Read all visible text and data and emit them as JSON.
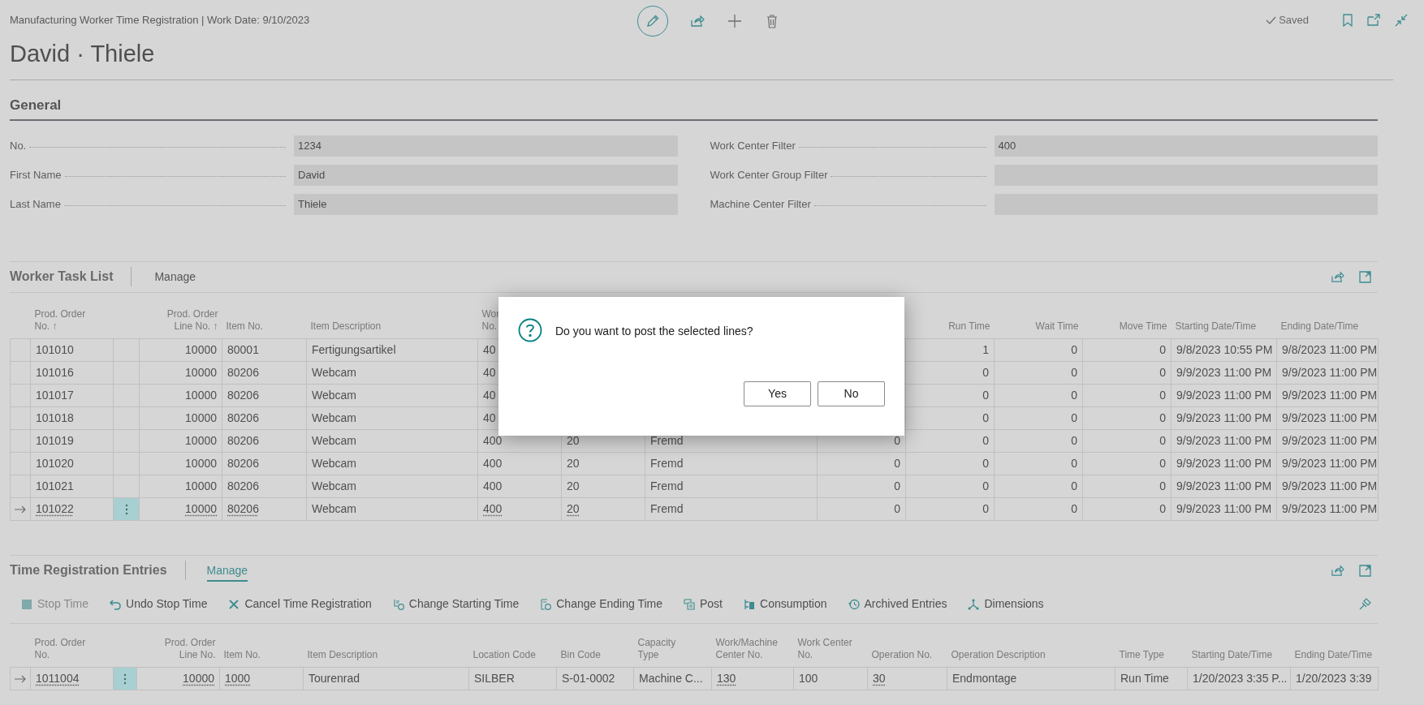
{
  "header": {
    "title": "Manufacturing Worker Time Registration | Work Date: 9/10/2023",
    "record_name": "David · Thiele",
    "status": "Saved"
  },
  "general": {
    "title": "General",
    "left_fields": [
      {
        "label": "No.",
        "value": "1234"
      },
      {
        "label": "First Name",
        "value": "David"
      },
      {
        "label": "Last Name",
        "value": "Thiele"
      }
    ],
    "right_fields": [
      {
        "label": "Work Center Filter",
        "value": "400"
      },
      {
        "label": "Work Center Group Filter"
      },
      {
        "label": "Machine Center Filter"
      }
    ]
  },
  "worker_task_list": {
    "title": "Worker Task List",
    "actions": [
      {
        "label": "Manage",
        "selected": false
      }
    ],
    "columns": [
      "Prod. Order\nNo. ↑",
      "Prod. Order\nLine No. ↑",
      "Item No.",
      "Item Description",
      "Wor\nNo.",
      null,
      null,
      null,
      "Run Time",
      "Wait Time",
      "Move Time",
      "Starting Date/Time",
      "Ending Date/Time"
    ],
    "rows": [
      {
        "focused": false,
        "cells": [
          "101010",
          "10000",
          "80001",
          "Fertigungsartikel",
          "40",
          null,
          null,
          null,
          "1",
          "0",
          "0",
          "9/8/2023 10:55 PM",
          "9/8/2023 11:00 PM"
        ]
      },
      {
        "focused": false,
        "cells": [
          "101016",
          "10000",
          "80206",
          "Webcam",
          "40",
          null,
          null,
          null,
          "0",
          "0",
          "0",
          "9/9/2023 11:00 PM",
          "9/9/2023 11:00 PM"
        ]
      },
      {
        "focused": false,
        "cells": [
          "101017",
          "10000",
          "80206",
          "Webcam",
          "40",
          null,
          null,
          null,
          "0",
          "0",
          "0",
          "9/9/2023 11:00 PM",
          "9/9/2023 11:00 PM"
        ]
      },
      {
        "focused": false,
        "cells": [
          "101018",
          "10000",
          "80206",
          "Webcam",
          "40",
          null,
          null,
          null,
          "0",
          "0",
          "0",
          "9/9/2023 11:00 PM",
          "9/9/2023 11:00 PM"
        ]
      },
      {
        "focused": false,
        "cells": [
          "101019",
          "10000",
          "80206",
          "Webcam",
          "400",
          "20",
          "Fremd",
          "0",
          "0",
          "0",
          "0",
          "9/9/2023 11:00 PM",
          "9/9/2023 11:00 PM"
        ]
      },
      {
        "focused": false,
        "cells": [
          "101020",
          "10000",
          "80206",
          "Webcam",
          "400",
          "20",
          "Fremd",
          "0",
          "0",
          "0",
          "0",
          "9/9/2023 11:00 PM",
          "9/9/2023 11:00 PM"
        ]
      },
      {
        "focused": false,
        "cells": [
          "101021",
          "10000",
          "80206",
          "Webcam",
          "400",
          "20",
          "Fremd",
          "0",
          "0",
          "0",
          "0",
          "9/9/2023 11:00 PM",
          "9/9/2023 11:00 PM"
        ]
      },
      {
        "focused": true,
        "cells": [
          "101022",
          "10000",
          "80206",
          "Webcam",
          "400",
          "20",
          "Fremd",
          "0",
          "0",
          "0",
          "0",
          "9/9/2023 11:00 PM",
          "9/9/2023 11:00 PM"
        ]
      }
    ]
  },
  "dialog": {
    "message": "Do you want to post the selected lines?",
    "buttons": [
      "Yes",
      "No"
    ]
  },
  "time_registration_entries": {
    "title": "Time Registration Entries",
    "actions": [
      {
        "label": "Manage",
        "selected": true
      }
    ],
    "toolbar": [
      {
        "label": "Stop Time",
        "disabled": true
      },
      {
        "label": "Undo Stop Time",
        "disabled": false
      },
      {
        "label": "Cancel Time Registration",
        "disabled": false
      },
      {
        "label": "Change Starting Time",
        "disabled": false
      },
      {
        "label": "Change Ending Time",
        "disabled": false
      },
      {
        "label": "Post",
        "disabled": false
      },
      {
        "label": "Consumption",
        "disabled": false
      },
      {
        "label": "Archived Entries",
        "disabled": false
      },
      {
        "label": "Dimensions",
        "disabled": false
      }
    ],
    "columns": [
      "Prod. Order\nNo.",
      "Prod. Order\nLine No.",
      "Item No.",
      "Item Description",
      "Location Code",
      "Bin Code",
      "Capacity\nType",
      "Work/Machine\nCenter No.",
      "Work Center\nNo.",
      "Operation No.",
      "Operation Description",
      "Time Type",
      "Starting Date/Time",
      "Ending Date/Time"
    ],
    "rows": [
      {
        "focused": true,
        "cells": [
          "1011004",
          "10000",
          "1000",
          "Tourenrad",
          "SILBER",
          "S-01-0002",
          "Machine C...",
          "130",
          "100",
          "30",
          "Endmontage",
          "Run Time",
          "1/20/2023 3:35 P...",
          "1/20/2023 3:39"
        ]
      }
    ]
  }
}
